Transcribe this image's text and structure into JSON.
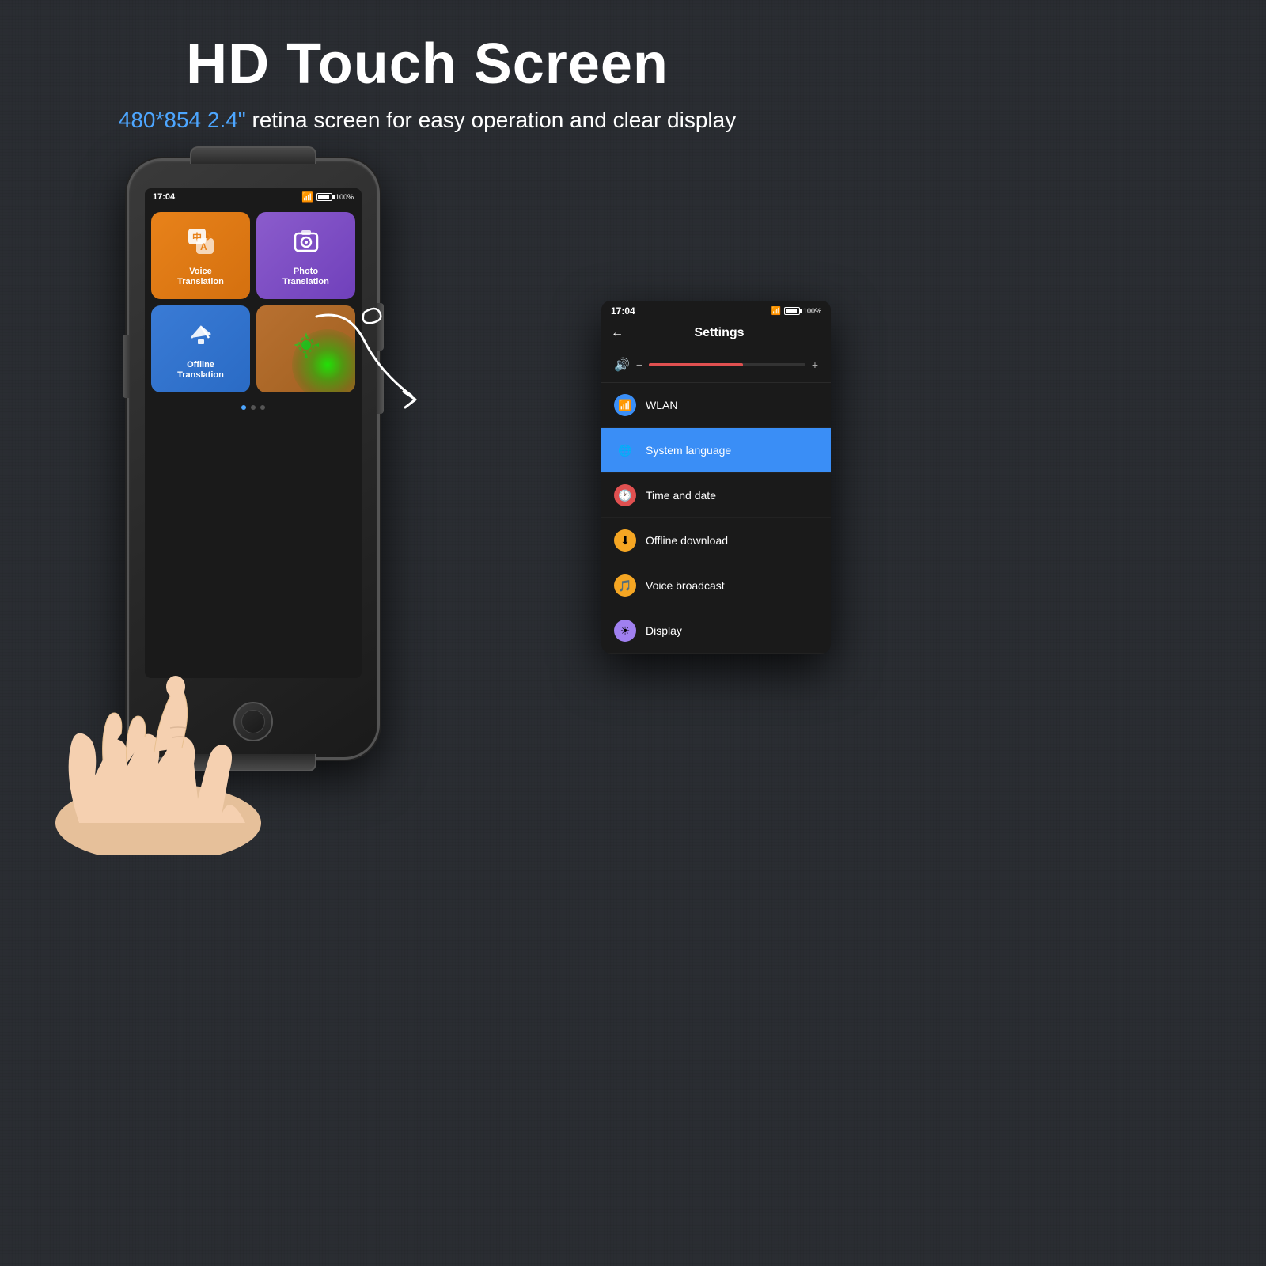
{
  "header": {
    "main_title": "HD Touch Screen",
    "subtitle_highlight": "480*854 2.4\"",
    "subtitle_rest": " retina screen for easy operation and clear display"
  },
  "device": {
    "status_time": "17:04",
    "battery_pct": "100%",
    "apps": [
      {
        "id": "voice",
        "label": "Voice\nTranslation",
        "icon": "🀄"
      },
      {
        "id": "photo",
        "label": "Photo\nTranslation",
        "icon": "📷"
      },
      {
        "id": "offline",
        "label": "Offline\nTranslation",
        "icon": "✈"
      },
      {
        "id": "settings",
        "label": "",
        "icon": "⚙"
      }
    ]
  },
  "settings_panel": {
    "status_time": "17:04",
    "battery_pct": "100%",
    "title": "Settings",
    "back_arrow": "←",
    "volume_minus": "−",
    "volume_plus": "+",
    "items": [
      {
        "id": "wlan",
        "label": "WLAN",
        "icon_type": "wifi"
      },
      {
        "id": "system_language",
        "label": "System language",
        "icon_type": "lang",
        "active": true
      },
      {
        "id": "time_date",
        "label": "Time and date",
        "icon_type": "time"
      },
      {
        "id": "offline_download",
        "label": "Offline download",
        "icon_type": "offline"
      },
      {
        "id": "voice_broadcast",
        "label": "Voice broadcast",
        "icon_type": "voice"
      },
      {
        "id": "display",
        "label": "Display",
        "icon_type": "display"
      }
    ]
  }
}
